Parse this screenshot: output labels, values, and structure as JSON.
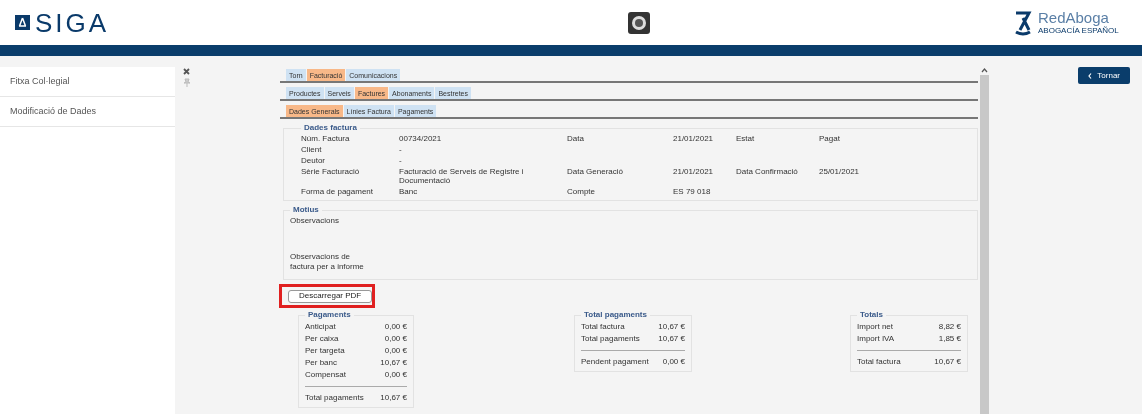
{
  "header": {
    "logo_text": "SIGA",
    "partner_name": "RedAboga",
    "partner_subtitle": "ABOGACÍA ESPAÑOL"
  },
  "sidebar": {
    "items": [
      {
        "label": "Fitxa Col·legial",
        "selected": false
      },
      {
        "label": "Modificació de Dades",
        "selected": false
      }
    ]
  },
  "tab_rows": [
    [
      {
        "label": "Torn",
        "selected": false
      },
      {
        "label": "Facturació",
        "selected": true
      },
      {
        "label": "Comunicacions",
        "selected": false
      }
    ],
    [
      {
        "label": "Productes",
        "selected": false
      },
      {
        "label": "Serveis",
        "selected": false
      },
      {
        "label": "Factures",
        "selected": true
      },
      {
        "label": "Abonaments",
        "selected": false
      },
      {
        "label": "Bestretes",
        "selected": false
      }
    ],
    [
      {
        "label": "Dades Generals",
        "selected": true
      },
      {
        "label": "Línies Factura",
        "selected": false
      },
      {
        "label": "Pagaments",
        "selected": false
      }
    ]
  ],
  "dades_factura": {
    "title": "Dades factura",
    "rows": [
      [
        "Núm. Factura",
        "00734/2021",
        "Data",
        "21/01/2021",
        "Estat",
        "Pagat"
      ],
      [
        "Client",
        "-"
      ],
      [
        "Deutor",
        "-"
      ],
      [
        "Sèrie Facturació",
        "Facturació de Serveis de Registre i Documentació",
        "Data Generació",
        "21/01/2021",
        "Data Confirmació",
        "25/01/2021"
      ],
      [
        "Forma de pagament",
        "Banc",
        "Compte",
        "ES 79 018"
      ]
    ]
  },
  "motius": {
    "title": "Motius",
    "labels": [
      "Observacions",
      "Observacions de factura per a informe"
    ]
  },
  "download_button": "Descarregar PDF",
  "pagaments": {
    "title": "Pagaments",
    "rows": [
      [
        "Anticipat",
        "0,00 €"
      ],
      [
        "Per caixa",
        "0,00 €"
      ],
      [
        "Per targeta",
        "0,00 €"
      ],
      [
        "Per banc",
        "10,67 €"
      ],
      [
        "Compensat",
        "0,00 €"
      ]
    ],
    "total": [
      "Total pagaments",
      "10,67 €"
    ]
  },
  "total_pagaments": {
    "title": "Total pagaments",
    "rows": [
      [
        "Total factura",
        "10,67 €"
      ],
      [
        "Total pagaments",
        "10,67 €"
      ]
    ],
    "total": [
      "Pendent pagament",
      "0,00 €"
    ]
  },
  "totals": {
    "title": "Totals",
    "rows": [
      [
        "Import net",
        "8,82 €"
      ],
      [
        "Import IVA",
        "1,85 €"
      ]
    ],
    "total": [
      "Total factura",
      "10,67 €"
    ]
  },
  "back_button": "Tornar"
}
